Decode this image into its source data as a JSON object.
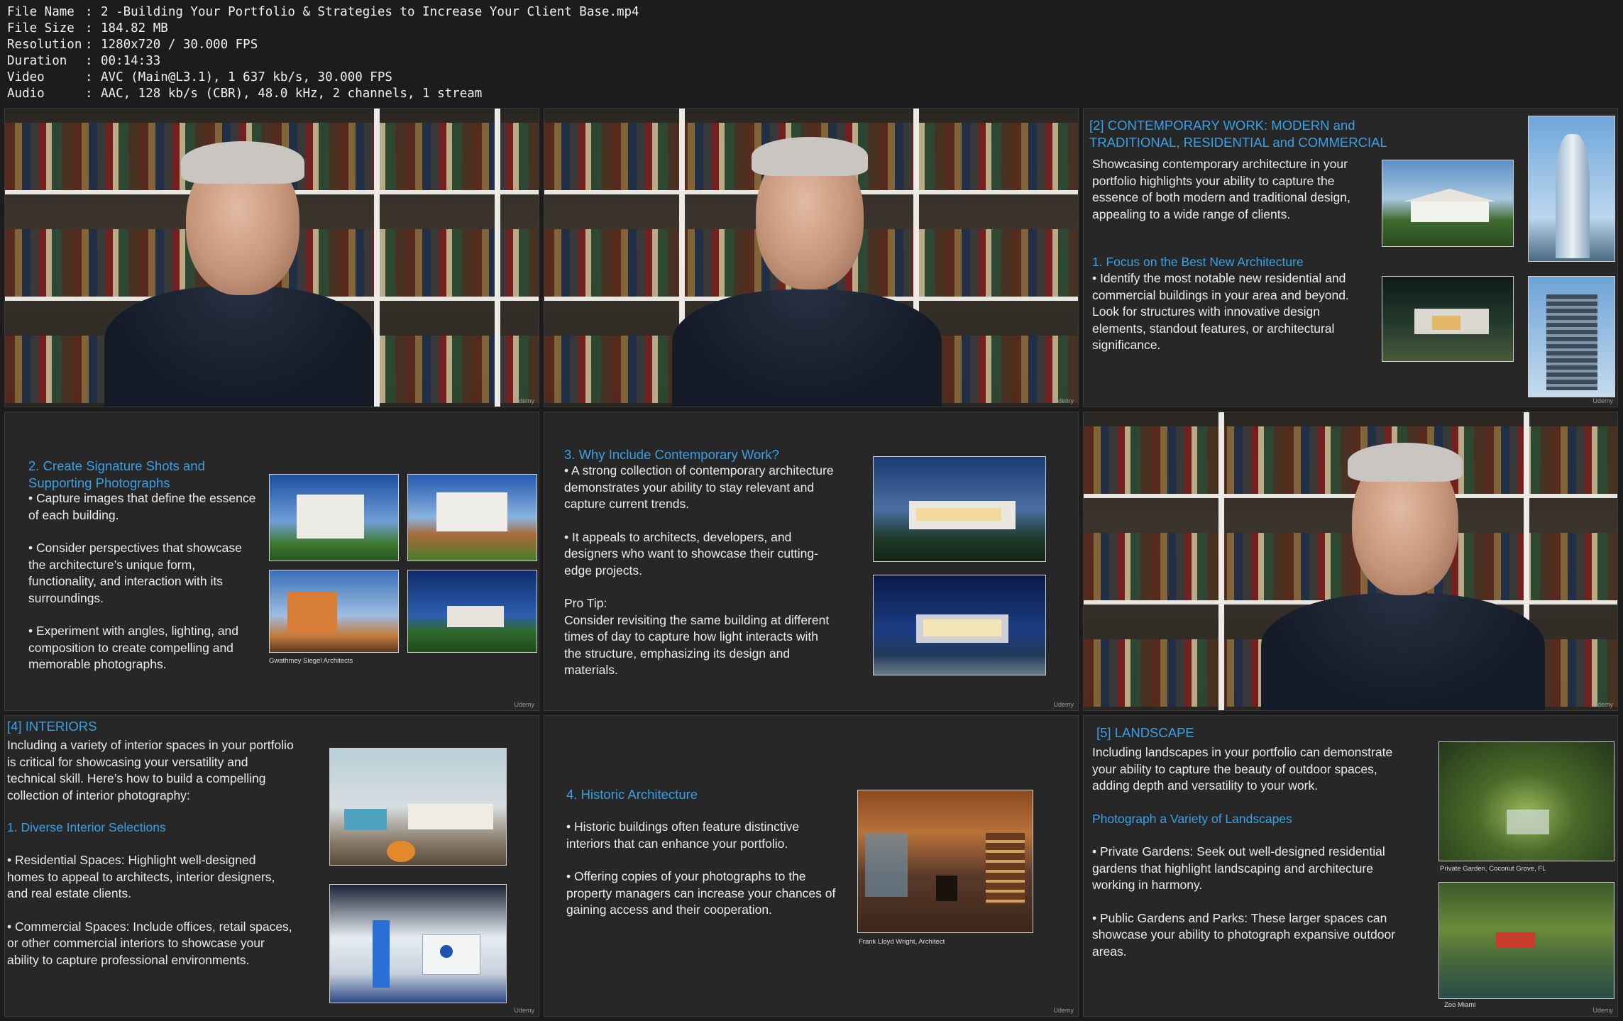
{
  "file_info": {
    "rows": [
      {
        "key": "File Name",
        "value": "2 -Building Your Portfolio & Strategies to Increase Your Client Base.mp4"
      },
      {
        "key": "File Size",
        "value": "184.82 MB"
      },
      {
        "key": "Resolution",
        "value": "1280x720 / 30.000 FPS"
      },
      {
        "key": "Duration",
        "value": "00:14:33"
      },
      {
        "key": "Video",
        "value": "AVC (Main@L3.1), 1 637 kb/s, 30.000 FPS"
      },
      {
        "key": "Audio",
        "value": "AAC, 128 kb/s (CBR), 48.0 kHz, 2 channels, 1 stream"
      }
    ]
  },
  "watermark": "Udemy",
  "tile_contemporary": {
    "heading_1": "[2] CONTEMPORARY WORK:  MODERN and",
    "heading_2": "TRADITIONAL, RESIDENTIAL and COMMERCIAL",
    "intro": "Showcasing contemporary architecture in your portfolio highlights your ability to capture the essence of both modern and traditional design, appealing to a wide range of clients.",
    "sub_heading": "1. Focus on the Best New Architecture",
    "bullet": "• Identify the most notable new residential and commercial buildings in your area and beyond. Look for structures with innovative design elements, standout features, or architectural significance."
  },
  "tile_signature": {
    "heading_1": "2. Create Signature Shots and",
    "heading_2": "Supporting Photographs",
    "bullets": [
      "• Capture images that define the essence of each building.",
      "• Consider perspectives that showcase the architecture’s unique form, functionality, and interaction with its surroundings.",
      "• Experiment with angles, lighting, and composition to create compelling and memorable photographs."
    ],
    "caption": "Gwathmey Siegel Architects"
  },
  "tile_why": {
    "heading": "3. Why Include Contemporary Work?",
    "bullets": [
      "• A strong collection of contemporary architecture demonstrates your ability to stay relevant and capture current trends.",
      "• It appeals to architects, developers, and designers who want to showcase their cutting-edge projects."
    ],
    "tip_label": "Pro Tip:",
    "tip_text": "Consider revisiting the same building at different times of day to capture how light interacts with the structure, emphasizing its design and materials."
  },
  "tile_interiors": {
    "heading": "[4] INTERIORS",
    "intro": "Including a variety of interior spaces in your portfolio is critical for showcasing your versatility and technical skill. Here’s how to build a compelling collection of interior photography:",
    "sub_heading": "1. Diverse Interior Selections",
    "bullets": [
      "• Residential Spaces: Highlight well-designed homes to appeal to architects, interior designers, and real estate clients.",
      "• Commercial Spaces: Include offices, retail spaces, or other commercial interiors to showcase your ability to capture professional environments."
    ]
  },
  "tile_historic": {
    "heading": "4. Historic Architecture",
    "bullets": [
      "• Historic buildings often feature distinctive interiors that can enhance your portfolio.",
      "• Offering copies of your photographs to the property managers can increase your chances of gaining access and their cooperation."
    ],
    "caption": "Frank Lloyd Wright, Architect"
  },
  "tile_landscape": {
    "heading": "[5] LANDSCAPE",
    "intro": "Including landscapes in your portfolio can demonstrate your ability to capture the beauty of outdoor spaces, adding depth and versatility to your work.",
    "sub_heading": "Photograph a Variety of Landscapes",
    "bullets": [
      "• Private Gardens: Seek out well-designed residential gardens that highlight landscaping and architecture working in harmony.",
      "• Public Gardens and Parks: These larger spaces can showcase your ability to photograph expansive outdoor areas."
    ],
    "caption_1": "Private Garden, Coconut Grove, FL",
    "caption_2": "Zoo Miami"
  }
}
